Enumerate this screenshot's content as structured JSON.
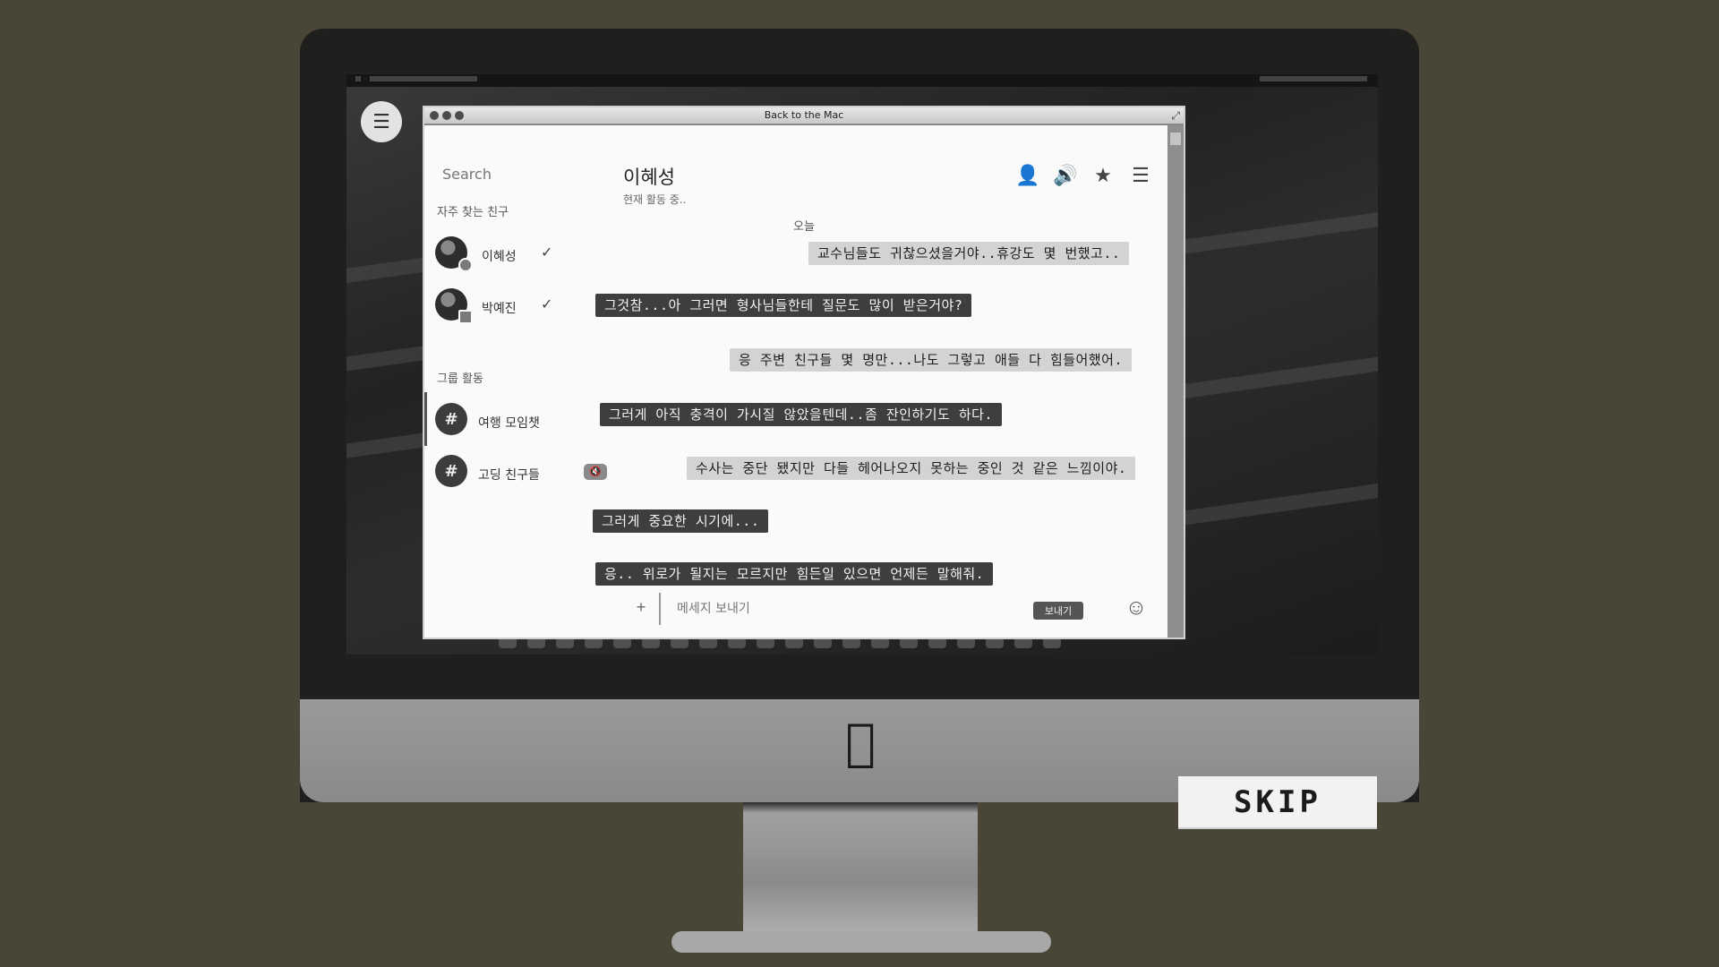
{
  "window": {
    "title": "Back to the Mac"
  },
  "sidebar": {
    "search_placeholder": "Search",
    "favorites_label": "자주 찾는 친구",
    "friends": [
      {
        "name": "이혜성",
        "icon": "check-icon"
      },
      {
        "name": "박예진",
        "icon": "check-icon"
      }
    ],
    "groups_label": "그룹 활동",
    "groups": [
      {
        "name": "여행 모임챗",
        "icon": "hash-icon",
        "active": true
      },
      {
        "name": "고딩 친구들",
        "icon": "hash-icon",
        "muted_icon": "mute-icon"
      }
    ]
  },
  "chat": {
    "name": "이혜성",
    "status": "현재 활동 중..",
    "date_label": "오늘",
    "header_icons": [
      "profile-icon",
      "speaker-icon",
      "star-icon",
      "menu-icon"
    ],
    "messages": [
      {
        "side": "out",
        "text": "교수님들도 귀찮으셨을거야..휴강도 몇 번했고.."
      },
      {
        "side": "in",
        "text": "그것참...아 그러면 형사님들한테 질문도 많이 받은거야?"
      },
      {
        "side": "out",
        "text": "응 주변 친구들 몇 명만...나도 그렇고 애들 다 힘들어했어."
      },
      {
        "side": "in",
        "text": "그러게 아직 충격이 가시질 않았을텐데..좀 잔인하기도 하다."
      },
      {
        "side": "out",
        "text": "수사는 중단 됐지만 다들 헤어나오지 못하는 중인 것 같은 느낌이야."
      },
      {
        "side": "in",
        "text": "그러게 중요한 시기에..."
      },
      {
        "side": "in",
        "text": "응.. 위로가 될지는 모르지만 힘든일 있으면 언제든 말해줘."
      }
    ],
    "composer": {
      "plus_label": "+",
      "placeholder": "메세지 보내기",
      "send_label": "보내기"
    }
  },
  "skip_label": "SKIP",
  "colors": {
    "background": "#4a4637",
    "bubble_in": "#3e3e3e",
    "bubble_out": "#d3d3d3"
  }
}
